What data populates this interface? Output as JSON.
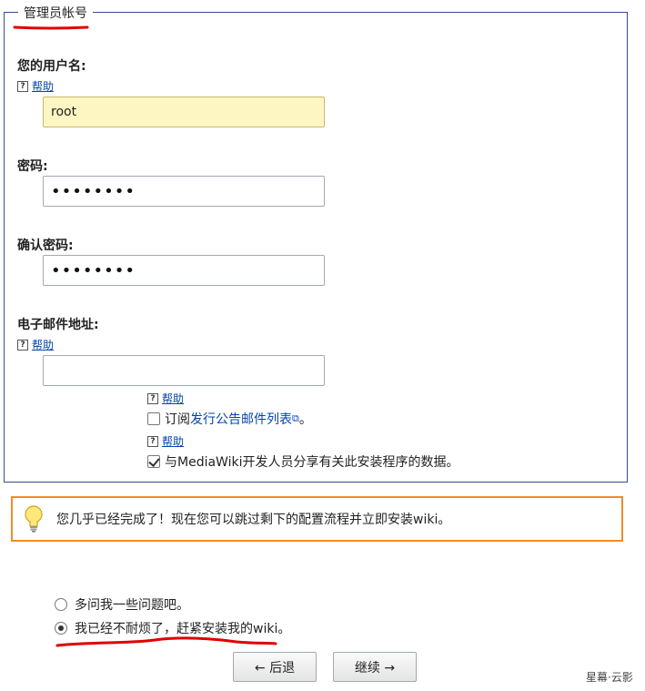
{
  "fieldset": {
    "legend": "管理员帐号"
  },
  "username": {
    "label": "您的用户名:",
    "help": "帮助",
    "value": "root"
  },
  "password": {
    "label": "密码:",
    "value": "••••••••"
  },
  "confirm_password": {
    "label": "确认密码:",
    "value": "••••••••"
  },
  "email": {
    "label": "电子邮件地址:",
    "help": "帮助",
    "value": ""
  },
  "subscribe": {
    "help": "帮助",
    "prefix": "订阅",
    "link": "发行公告邮件列表",
    "suffix": "。",
    "checked": false
  },
  "share": {
    "help": "帮助",
    "label": "与MediaWiki开发人员分享有关此安装程序的数据。",
    "checked": true
  },
  "notice": {
    "text": "您几乎已经完成了！现在您可以跳过剩下的配置流程并立即安装wiki。",
    "border_color": "#f08c28"
  },
  "options": [
    {
      "label": "多问我一些问题吧。",
      "selected": false
    },
    {
      "label": "我已经不耐烦了，赶紧安装我的wiki。",
      "selected": true
    }
  ],
  "buttons": {
    "back": "← 后退",
    "continue": "继续 →"
  },
  "watermark": "星幕·云影",
  "colors": {
    "link": "#0645ad",
    "annotation": "#e00000",
    "input_filled": "#fef6c2"
  }
}
